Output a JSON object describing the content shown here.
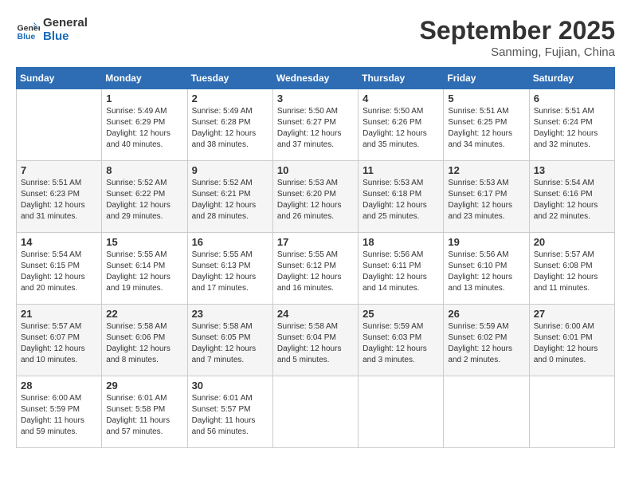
{
  "header": {
    "logo_line1": "General",
    "logo_line2": "Blue",
    "month_title": "September 2025",
    "subtitle": "Sanming, Fujian, China"
  },
  "days_of_week": [
    "Sunday",
    "Monday",
    "Tuesday",
    "Wednesday",
    "Thursday",
    "Friday",
    "Saturday"
  ],
  "weeks": [
    [
      {
        "day": null
      },
      {
        "day": 1,
        "sunrise": "5:49 AM",
        "sunset": "6:29 PM",
        "daylight": "12 hours and 40 minutes."
      },
      {
        "day": 2,
        "sunrise": "5:49 AM",
        "sunset": "6:28 PM",
        "daylight": "12 hours and 38 minutes."
      },
      {
        "day": 3,
        "sunrise": "5:50 AM",
        "sunset": "6:27 PM",
        "daylight": "12 hours and 37 minutes."
      },
      {
        "day": 4,
        "sunrise": "5:50 AM",
        "sunset": "6:26 PM",
        "daylight": "12 hours and 35 minutes."
      },
      {
        "day": 5,
        "sunrise": "5:51 AM",
        "sunset": "6:25 PM",
        "daylight": "12 hours and 34 minutes."
      },
      {
        "day": 6,
        "sunrise": "5:51 AM",
        "sunset": "6:24 PM",
        "daylight": "12 hours and 32 minutes."
      }
    ],
    [
      {
        "day": 7,
        "sunrise": "5:51 AM",
        "sunset": "6:23 PM",
        "daylight": "12 hours and 31 minutes."
      },
      {
        "day": 8,
        "sunrise": "5:52 AM",
        "sunset": "6:22 PM",
        "daylight": "12 hours and 29 minutes."
      },
      {
        "day": 9,
        "sunrise": "5:52 AM",
        "sunset": "6:21 PM",
        "daylight": "12 hours and 28 minutes."
      },
      {
        "day": 10,
        "sunrise": "5:53 AM",
        "sunset": "6:20 PM",
        "daylight": "12 hours and 26 minutes."
      },
      {
        "day": 11,
        "sunrise": "5:53 AM",
        "sunset": "6:18 PM",
        "daylight": "12 hours and 25 minutes."
      },
      {
        "day": 12,
        "sunrise": "5:53 AM",
        "sunset": "6:17 PM",
        "daylight": "12 hours and 23 minutes."
      },
      {
        "day": 13,
        "sunrise": "5:54 AM",
        "sunset": "6:16 PM",
        "daylight": "12 hours and 22 minutes."
      }
    ],
    [
      {
        "day": 14,
        "sunrise": "5:54 AM",
        "sunset": "6:15 PM",
        "daylight": "12 hours and 20 minutes."
      },
      {
        "day": 15,
        "sunrise": "5:55 AM",
        "sunset": "6:14 PM",
        "daylight": "12 hours and 19 minutes."
      },
      {
        "day": 16,
        "sunrise": "5:55 AM",
        "sunset": "6:13 PM",
        "daylight": "12 hours and 17 minutes."
      },
      {
        "day": 17,
        "sunrise": "5:55 AM",
        "sunset": "6:12 PM",
        "daylight": "12 hours and 16 minutes."
      },
      {
        "day": 18,
        "sunrise": "5:56 AM",
        "sunset": "6:11 PM",
        "daylight": "12 hours and 14 minutes."
      },
      {
        "day": 19,
        "sunrise": "5:56 AM",
        "sunset": "6:10 PM",
        "daylight": "12 hours and 13 minutes."
      },
      {
        "day": 20,
        "sunrise": "5:57 AM",
        "sunset": "6:08 PM",
        "daylight": "12 hours and 11 minutes."
      }
    ],
    [
      {
        "day": 21,
        "sunrise": "5:57 AM",
        "sunset": "6:07 PM",
        "daylight": "12 hours and 10 minutes."
      },
      {
        "day": 22,
        "sunrise": "5:58 AM",
        "sunset": "6:06 PM",
        "daylight": "12 hours and 8 minutes."
      },
      {
        "day": 23,
        "sunrise": "5:58 AM",
        "sunset": "6:05 PM",
        "daylight": "12 hours and 7 minutes."
      },
      {
        "day": 24,
        "sunrise": "5:58 AM",
        "sunset": "6:04 PM",
        "daylight": "12 hours and 5 minutes."
      },
      {
        "day": 25,
        "sunrise": "5:59 AM",
        "sunset": "6:03 PM",
        "daylight": "12 hours and 3 minutes."
      },
      {
        "day": 26,
        "sunrise": "5:59 AM",
        "sunset": "6:02 PM",
        "daylight": "12 hours and 2 minutes."
      },
      {
        "day": 27,
        "sunrise": "6:00 AM",
        "sunset": "6:01 PM",
        "daylight": "12 hours and 0 minutes."
      }
    ],
    [
      {
        "day": 28,
        "sunrise": "6:00 AM",
        "sunset": "5:59 PM",
        "daylight": "11 hours and 59 minutes."
      },
      {
        "day": 29,
        "sunrise": "6:01 AM",
        "sunset": "5:58 PM",
        "daylight": "11 hours and 57 minutes."
      },
      {
        "day": 30,
        "sunrise": "6:01 AM",
        "sunset": "5:57 PM",
        "daylight": "11 hours and 56 minutes."
      },
      {
        "day": null
      },
      {
        "day": null
      },
      {
        "day": null
      },
      {
        "day": null
      }
    ]
  ]
}
